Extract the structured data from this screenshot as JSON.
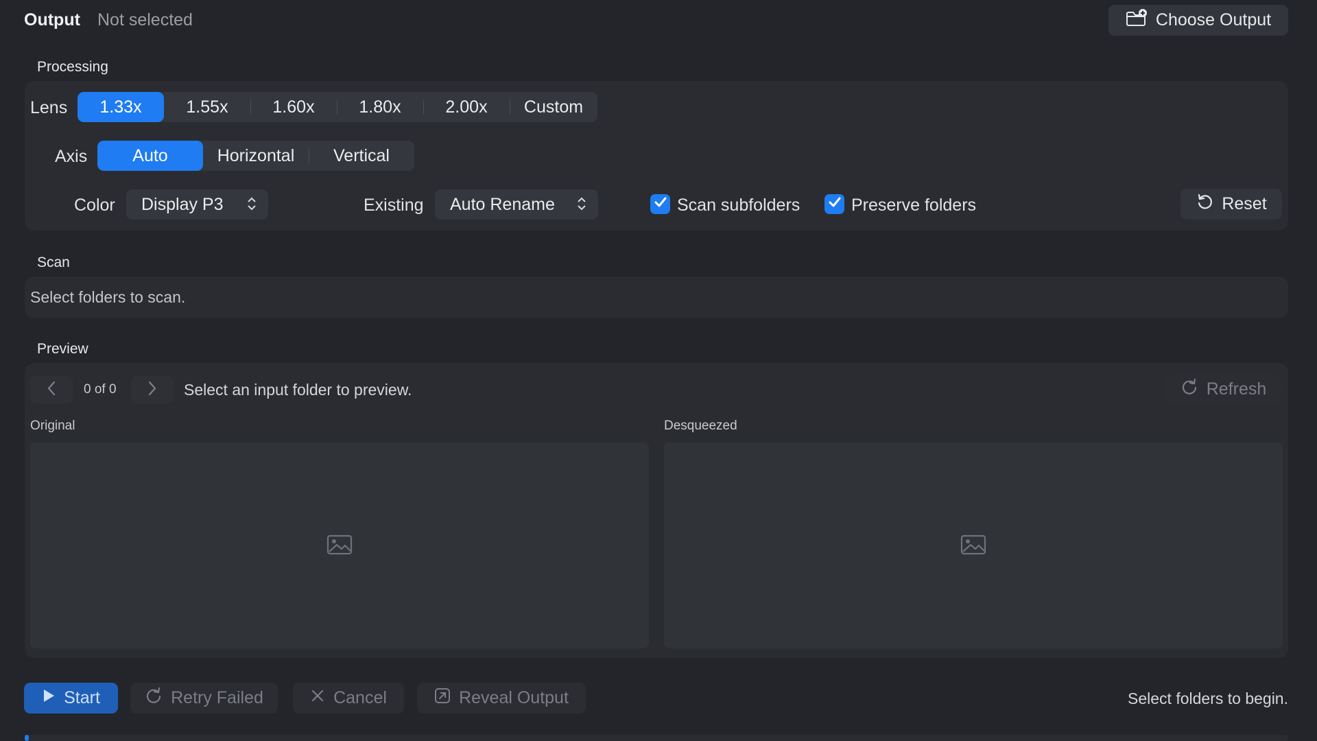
{
  "output": {
    "label": "Output",
    "value": "Not selected",
    "choose_button": "Choose Output",
    "choose_icon": "folder-badge-plus-icon"
  },
  "processing": {
    "title": "Processing",
    "lens_label": "Lens",
    "lens_options": [
      "1.33x",
      "1.55x",
      "1.60x",
      "1.80x",
      "2.00x",
      "Custom"
    ],
    "lens_selected": "1.33x",
    "axis_label": "Axis",
    "axis_options": [
      "Auto",
      "Horizontal",
      "Vertical"
    ],
    "axis_selected": "Auto",
    "color_label": "Color",
    "color_value": "Display P3",
    "existing_label": "Existing",
    "existing_value": "Auto Rename",
    "scan_subfolders_label": "Scan subfolders",
    "scan_subfolders_checked": true,
    "preserve_folders_label": "Preserve folders",
    "preserve_folders_checked": true,
    "reset_button": "Reset"
  },
  "scan": {
    "title": "Scan",
    "message": "Select folders to scan."
  },
  "preview": {
    "title": "Preview",
    "counter": "0 of 0",
    "message": "Select an input folder to preview.",
    "refresh_button": "Refresh",
    "original_label": "Original",
    "desqueezed_label": "Desqueezed"
  },
  "actions": {
    "start": "Start",
    "retry_failed": "Retry Failed",
    "cancel": "Cancel",
    "reveal_output": "Reveal Output",
    "status": "Select folders to begin."
  },
  "colors": {
    "accent": "#1f7cf2",
    "background": "#23252a",
    "panel": "#2a2c31"
  }
}
